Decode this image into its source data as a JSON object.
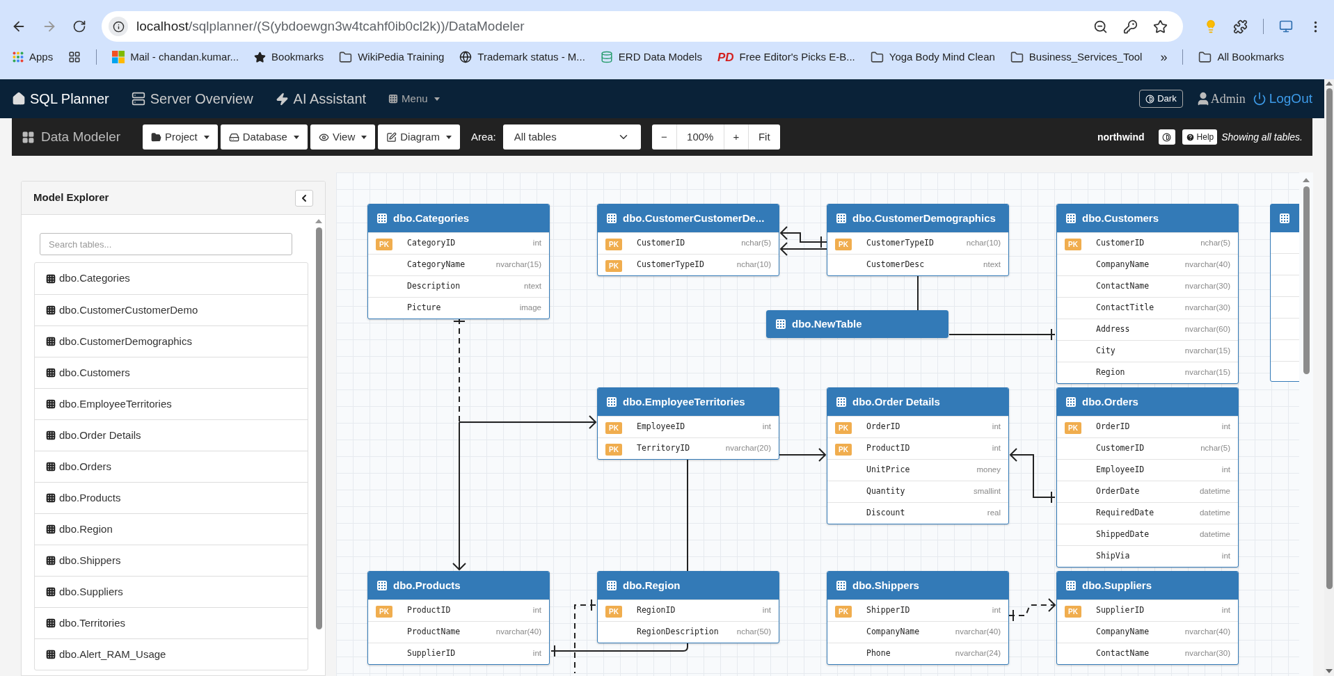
{
  "browser": {
    "address": {
      "host": "localhost",
      "path": "/sqlplanner/(S(ybdoewgn3w4tcahf0ib0cl2k))/DataModeler"
    },
    "bookmarks": [
      {
        "kind": "apps",
        "label": "Apps"
      },
      {
        "kind": "grid"
      },
      {
        "kind": "windows",
        "label": "Mail - chandan.kumar..."
      },
      {
        "kind": "star",
        "label": "Bookmarks"
      },
      {
        "kind": "folder",
        "label": "WikiPedia Training"
      },
      {
        "kind": "globe",
        "label": "Trademark status - M..."
      },
      {
        "kind": "database",
        "label": "ERD Data Models"
      },
      {
        "kind": "pd",
        "badge": "PD",
        "label": "Free Editor's Picks E-B..."
      },
      {
        "kind": "folder",
        "label": "Yoga Body Mind Clean"
      },
      {
        "kind": "folder",
        "label": "Business_Services_Tool"
      }
    ],
    "overflow": "»",
    "all_bookmarks": "All Bookmarks"
  },
  "nav": {
    "brand": "SQL Planner",
    "links": [
      {
        "kind": "server",
        "label": "Server Overview"
      },
      {
        "kind": "ai",
        "label": "AI Assistant"
      }
    ],
    "menu": "Menu",
    "theme_button": "Dark",
    "user": "Admin",
    "logout": "LogOut"
  },
  "toolbar": {
    "title": "Data Modeler",
    "menus": [
      {
        "kind": "project",
        "label": "Project"
      },
      {
        "kind": "database",
        "label": "Database"
      },
      {
        "kind": "view",
        "label": "View"
      },
      {
        "kind": "diagram",
        "label": "Diagram"
      }
    ],
    "area_label": "Area:",
    "area_value": "All tables",
    "zoom_out": "−",
    "zoom_level": "100%",
    "zoom_in": "+",
    "fit": "Fit",
    "database": "northwind",
    "help": "Help",
    "status": "Showing all tables."
  },
  "explorer": {
    "title": "Model Explorer",
    "search_placeholder": "Search tables...",
    "items": [
      "dbo.Categories",
      "dbo.CustomerCustomerDemo",
      "dbo.CustomerDemographics",
      "dbo.Customers",
      "dbo.EmployeeTerritories",
      "dbo.Order Details",
      "dbo.Orders",
      "dbo.Products",
      "dbo.Region",
      "dbo.Shippers",
      "dbo.Suppliers",
      "dbo.Territories",
      "dbo.Alert_RAM_Usage"
    ]
  },
  "diagram": {
    "tables": [
      {
        "name": "dbo.Categories",
        "columns": [
          {
            "badge": "PK",
            "name": "CategoryID",
            "type": "int"
          },
          {
            "name": "CategoryName",
            "type": "nvarchar(15)"
          },
          {
            "name": "Description",
            "type": "ntext"
          },
          {
            "name": "Picture",
            "type": "image"
          }
        ]
      },
      {
        "name": "dbo.CustomerCustomerDe...",
        "columns": [
          {
            "badge": "PK",
            "name": "CustomerID",
            "type": "nchar(5)"
          },
          {
            "badge": "PK",
            "name": "CustomerTypeID",
            "type": "nchar(10)"
          }
        ]
      },
      {
        "name": "dbo.CustomerDemographics",
        "columns": [
          {
            "badge": "PK",
            "name": "CustomerTypeID",
            "type": "nchar(10)"
          },
          {
            "name": "CustomerDesc",
            "type": "ntext"
          }
        ]
      },
      {
        "name": "dbo.Customers",
        "columns": [
          {
            "badge": "PK",
            "name": "CustomerID",
            "type": "nchar(5)"
          },
          {
            "name": "CompanyName",
            "type": "nvarchar(40)"
          },
          {
            "name": "ContactName",
            "type": "nvarchar(30)"
          },
          {
            "name": "ContactTitle",
            "type": "nvarchar(30)"
          },
          {
            "name": "Address",
            "type": "nvarchar(60)"
          },
          {
            "name": "City",
            "type": "nvarchar(15)"
          },
          {
            "name": "Region",
            "type": "nvarchar(15)"
          }
        ]
      },
      {
        "name": "dbo.NewTable"
      },
      {
        "name": "dbo.EmployeeTerritories",
        "columns": [
          {
            "badge": "PK",
            "name": "EmployeeID",
            "type": "int"
          },
          {
            "badge": "PK",
            "name": "TerritoryID",
            "type": "nvarchar(20)"
          }
        ]
      },
      {
        "name": "dbo.Order Details",
        "columns": [
          {
            "badge": "PK",
            "name": "OrderID",
            "type": "int"
          },
          {
            "badge": "PK",
            "name": "ProductID",
            "type": "int"
          },
          {
            "name": "UnitPrice",
            "type": "money"
          },
          {
            "name": "Quantity",
            "type": "smallint"
          },
          {
            "name": "Discount",
            "type": "real"
          }
        ]
      },
      {
        "name": "dbo.Orders",
        "columns": [
          {
            "badge": "PK",
            "name": "OrderID",
            "type": "int"
          },
          {
            "name": "CustomerID",
            "type": "nchar(5)"
          },
          {
            "name": "EmployeeID",
            "type": "int"
          },
          {
            "name": "OrderDate",
            "type": "datetime"
          },
          {
            "name": "RequiredDate",
            "type": "datetime"
          },
          {
            "name": "ShippedDate",
            "type": "datetime"
          },
          {
            "name": "ShipVia",
            "type": "int"
          }
        ]
      },
      {
        "name": "dbo.Products",
        "columns": [
          {
            "badge": "PK",
            "name": "ProductID",
            "type": "int"
          },
          {
            "name": "ProductName",
            "type": "nvarchar(40)"
          },
          {
            "name": "SupplierID",
            "type": "int"
          }
        ]
      },
      {
        "name": "dbo.Region",
        "columns": [
          {
            "badge": "PK",
            "name": "RegionID",
            "type": "int"
          },
          {
            "name": "RegionDescription",
            "type": "nchar(50)"
          }
        ]
      },
      {
        "name": "dbo.Shippers",
        "columns": [
          {
            "badge": "PK",
            "name": "ShipperID",
            "type": "int"
          },
          {
            "name": "CompanyName",
            "type": "nvarchar(40)"
          },
          {
            "name": "Phone",
            "type": "nvarchar(24)"
          }
        ]
      },
      {
        "name": "dbo.Suppliers",
        "columns": [
          {
            "badge": "PK",
            "name": "SupplierID",
            "type": "int"
          },
          {
            "name": "CompanyName",
            "type": "nvarchar(40)"
          },
          {
            "name": "ContactName",
            "type": "nvarchar(30)"
          }
        ]
      }
    ]
  }
}
